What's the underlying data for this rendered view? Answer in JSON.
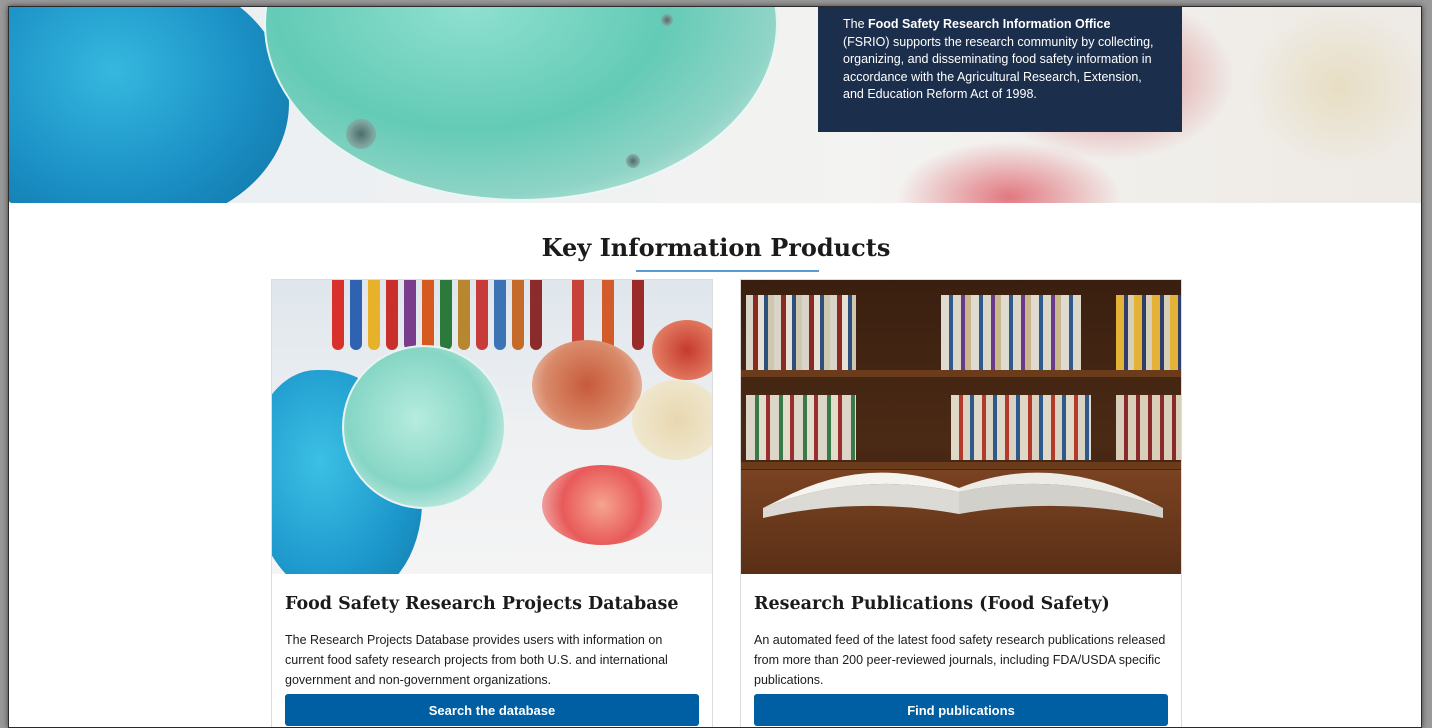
{
  "hero": {
    "intro_prefix": "The ",
    "intro_bold": "Food Safety Research Information Office",
    "intro_suffix": " (FSRIO) supports the research community by collecting, organizing, and disseminating food safety information in accordance with the Agricultural Research, Extension, and Education Reform Act of 1998."
  },
  "section": {
    "title": "Key Information Products"
  },
  "cards": [
    {
      "title": "Food Safety Research Projects Database",
      "description": "The Research Projects Database provides users with information on current food safety research projects from both U.S. and international government and non-government organizations.",
      "button_label": "Search the database"
    },
    {
      "title": "Research Publications (Food Safety)",
      "description": "An automated feed of the latest food safety research publications released from more than 200 peer-reviewed journals, including FDA/USDA specific publications.",
      "button_label": "Find publications"
    }
  ],
  "colors": {
    "intro_bg": "#1b2e4c",
    "button_bg": "#005ea2",
    "title_rule": "#5b9bd5"
  }
}
